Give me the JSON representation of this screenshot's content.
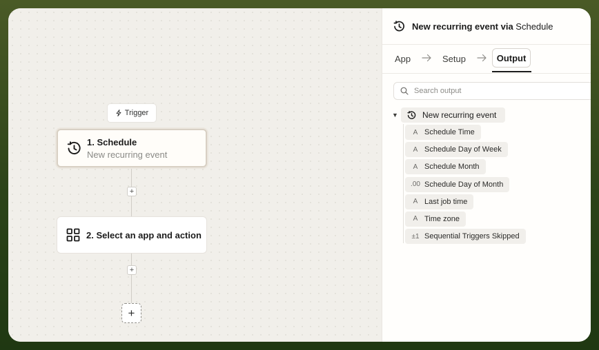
{
  "canvas": {
    "trigger_label": "Trigger",
    "steps": [
      {
        "title": "1. Schedule",
        "subtitle": "New recurring event",
        "icon": "schedule-clock-icon"
      },
      {
        "title": "2. Select an app and action",
        "icon": "apps-grid-icon"
      }
    ],
    "add_step_symbol": "+"
  },
  "panel": {
    "title_event": "New recurring event via",
    "title_app": "Schedule",
    "tabs": [
      {
        "label": "App"
      },
      {
        "label": "Setup"
      },
      {
        "label": "Output",
        "active": true
      }
    ],
    "search": {
      "placeholder": "Search output",
      "value": ""
    },
    "tree": {
      "root_label": "New recurring event",
      "expanded": true,
      "items": [
        {
          "icon_text": "A",
          "label": "Schedule Time"
        },
        {
          "icon_text": "A",
          "label": "Schedule Day of Week"
        },
        {
          "icon_text": "A",
          "label": "Schedule Month"
        },
        {
          "icon_text": ".00",
          "label": "Schedule Day of Month"
        },
        {
          "icon_text": "A",
          "label": "Last job time"
        },
        {
          "icon_text": "A",
          "label": "Time zone"
        },
        {
          "icon_text": "±1",
          "label": "Sequential Triggers Skipped"
        }
      ]
    }
  },
  "colors": {
    "frame_green": "#2c4319",
    "canvas_bg": "#f1efea",
    "panel_bg": "#fffefc",
    "text_primary": "#1b1b1b",
    "text_muted": "#8a8a86"
  }
}
